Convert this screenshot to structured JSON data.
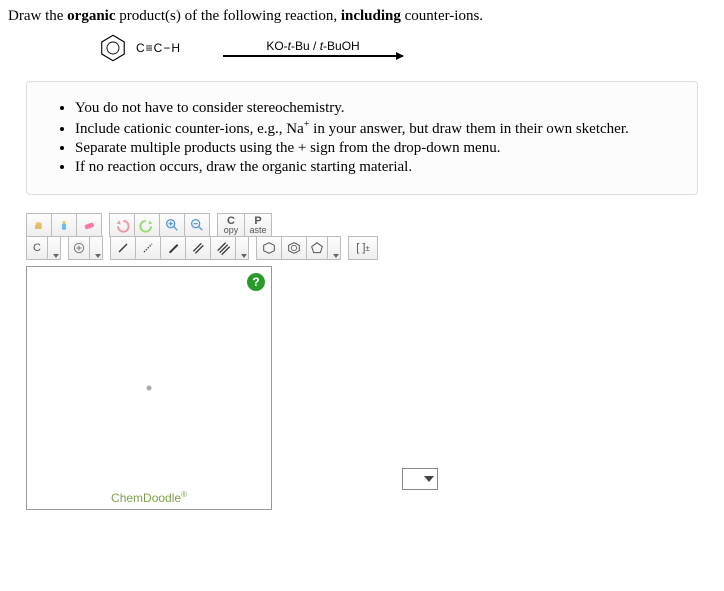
{
  "prompt": {
    "pre": "Draw the ",
    "b1": "organic",
    "mid": " product(s) of the following reaction, ",
    "b2": "including",
    "post": " counter-ions."
  },
  "reaction": {
    "substituent": "C≡C−H",
    "reagent_html": "KO-t-Bu / t-BuOH"
  },
  "hints": {
    "i1": "You do not have to consider stereochemistry.",
    "i2a": "Include cationic counter-ions, e.g., Na",
    "i2b": " in your answer, but draw them in their own sketcher.",
    "i3": "Separate multiple products using the + sign from the drop-down menu.",
    "i4": "If no reaction occurs, draw the organic starting material."
  },
  "tb": {
    "copy_big": "C",
    "copy_small": "opy",
    "paste_big": "P",
    "paste_small": "aste",
    "atom": "C",
    "charge": "[ ]"
  },
  "canvas": {
    "help": "?",
    "brand": "ChemDoodle"
  }
}
